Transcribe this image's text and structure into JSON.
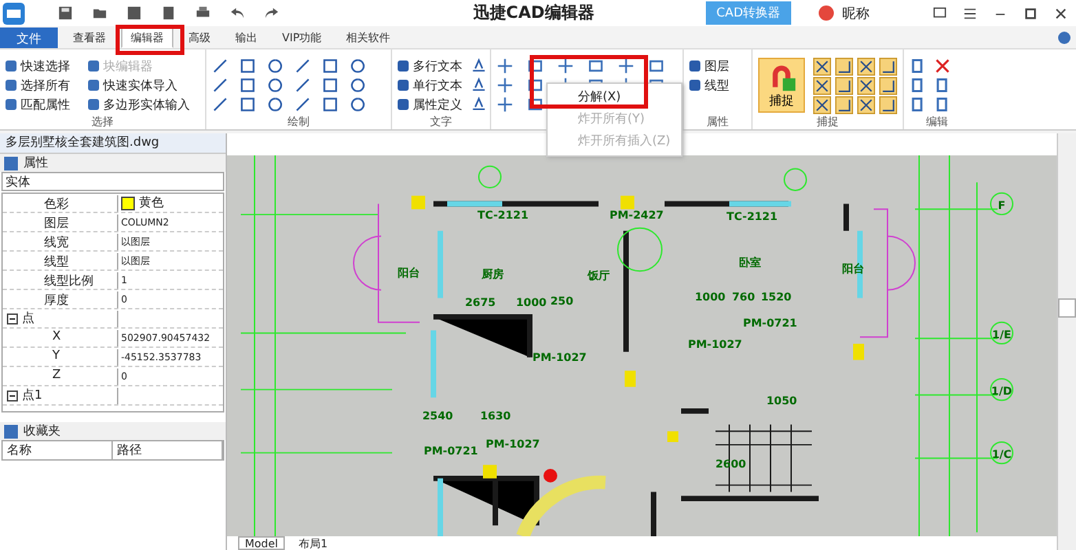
{
  "window": {
    "title": "迅捷CAD编辑器",
    "converter_button": "CAD转换器",
    "user": "昵称"
  },
  "tabs": [
    {
      "label": "文件",
      "kind": "file",
      "selected": false
    },
    {
      "label": "查看器",
      "kind": "tab",
      "selected": false
    },
    {
      "label": "编辑器",
      "kind": "tab",
      "selected": true
    },
    {
      "label": "高级",
      "kind": "tab",
      "selected": false
    },
    {
      "label": "输出",
      "kind": "tab",
      "selected": false
    },
    {
      "label": "VIP功能",
      "kind": "tab",
      "selected": false
    },
    {
      "label": "相关软件",
      "kind": "tab",
      "selected": false
    }
  ],
  "ribbon": {
    "select": {
      "label": "选择",
      "items": [
        {
          "label": "快速选择",
          "disabled": false
        },
        {
          "label": "块编辑器",
          "disabled": true
        },
        {
          "label": "选择所有",
          "disabled": false
        },
        {
          "label": "快速实体导入",
          "disabled": false
        },
        {
          "label": "匹配属性",
          "disabled": false
        },
        {
          "label": "多边形实体输入",
          "disabled": false
        }
      ]
    },
    "draw": {
      "label": "绘制"
    },
    "text": {
      "label": "文字",
      "items": [
        "多行文本",
        "单行文本",
        "属性定义"
      ]
    },
    "properties": {
      "label": "属性",
      "items": [
        "图层",
        "线型"
      ]
    },
    "snap": {
      "label": "捕捉",
      "button": "捕捉",
      "on": true
    },
    "edit": {
      "label": "编辑"
    }
  },
  "dropdown_menu": [
    {
      "label": "分解(X)",
      "disabled": false
    },
    {
      "label": "炸开所有(Y)",
      "disabled": true
    },
    {
      "label": "炸开所有插入(Z)",
      "disabled": true
    }
  ],
  "document_tab": "多层别墅核全套建筑图.dwg",
  "properties_panel": {
    "title": "属性",
    "entity_type": "实体",
    "rows": [
      {
        "name": "色彩",
        "value": "黄色",
        "kind": "color",
        "color": "#ffff00"
      },
      {
        "name": "图层",
        "value": "COLUMN2",
        "kind": "value"
      },
      {
        "name": "线宽",
        "value": "以图层",
        "kind": "value"
      },
      {
        "name": "线型",
        "value": "以图层",
        "kind": "value"
      },
      {
        "name": "线型比例",
        "value": "1",
        "kind": "value"
      },
      {
        "name": "厚度",
        "value": "0",
        "kind": "value"
      },
      {
        "name": "点",
        "kind": "group",
        "expanded": true,
        "children": [
          {
            "name": "X",
            "value": "502907.90457432"
          },
          {
            "name": "Y",
            "value": "-45152.3537783"
          },
          {
            "name": "Z",
            "value": "0"
          }
        ]
      },
      {
        "name": "点1",
        "kind": "group",
        "expanded": true,
        "children": []
      }
    ]
  },
  "favorites_panel": {
    "title": "收藏夹",
    "columns": [
      "名称",
      "路径"
    ]
  },
  "drawing_labels": [
    "TC-2121",
    "PM-2427",
    "TC-2121",
    "F",
    "阳台",
    "厨房",
    "饭厅",
    "卧室",
    "阳台",
    "2675",
    "1000",
    "250",
    "1000",
    "760",
    "1520",
    "PM-1027",
    "PM-1027",
    "PM-0721",
    "1/E",
    "1/D",
    "2540",
    "1630",
    "1050",
    "PM-0721",
    "PM-1027",
    "2600",
    "1/C"
  ],
  "layout_tabs": [
    {
      "label": "Model",
      "selected": true
    },
    {
      "label": "布局1",
      "selected": false
    }
  ]
}
